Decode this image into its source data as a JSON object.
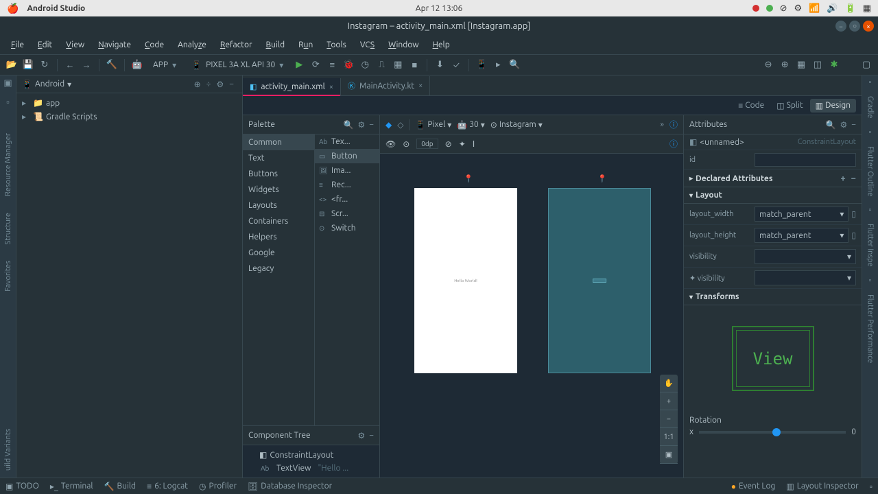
{
  "macos": {
    "app": "Android Studio",
    "datetime": "Apr 12  13:06"
  },
  "window": {
    "title": "Instagram – activity_main.xml [Instagram.app]"
  },
  "menu": [
    "File",
    "Edit",
    "View",
    "Navigate",
    "Code",
    "Analyze",
    "Refactor",
    "Build",
    "Run",
    "Tools",
    "VCS",
    "Window",
    "Help"
  ],
  "toolbar": {
    "config": "APP",
    "device": "PIXEL 3A XL API 30"
  },
  "project": {
    "view": "Android",
    "items": [
      "app",
      "Gradle Scripts"
    ]
  },
  "tabs": [
    {
      "name": "activity_main.xml",
      "active": true
    },
    {
      "name": "MainActivity.kt",
      "active": false
    }
  ],
  "view_modes": [
    "Code",
    "Split",
    "Design"
  ],
  "palette": {
    "title": "Palette",
    "categories": [
      "Common",
      "Text",
      "Buttons",
      "Widgets",
      "Layouts",
      "Containers",
      "Helpers",
      "Google",
      "Legacy"
    ],
    "items": [
      "Tex...",
      "Button",
      "Ima...",
      "Rec...",
      "<fr...",
      "Scr...",
      "Switch"
    ]
  },
  "component_tree": {
    "title": "Component Tree",
    "root": "ConstraintLayout",
    "child": "TextView",
    "child_text": "\"Hello ..."
  },
  "canvas": {
    "device_drop": "Pixel",
    "api_drop": "30",
    "theme_drop": "Instagram",
    "default_margin": "0dp",
    "hello_text": "Hello World!"
  },
  "attributes": {
    "title": "Attributes",
    "component": "<unnamed>",
    "type": "ConstraintLayout",
    "id_label": "id",
    "declared": "Declared Attributes",
    "layout": "Layout",
    "width_label": "layout_width",
    "width_value": "match_parent",
    "height_label": "layout_height",
    "height_value": "match_parent",
    "visibility_label": "visibility",
    "visibility2_label": "visibility",
    "transforms": "Transforms",
    "view_text": "View",
    "rotation": "Rotation",
    "rotation_axis": "x",
    "rotation_value": "0"
  },
  "left_tools": [
    "Resource Manager",
    "Structure",
    "Favorites",
    "uild Variants"
  ],
  "right_tools": [
    "Gradle",
    "Flutter Outline",
    "Flutter Inspe",
    "Flutter Performance"
  ],
  "status": {
    "todo": "TODO",
    "terminal": "Terminal",
    "build": "Build",
    "logcat": "6: Logcat",
    "profiler": "Profiler",
    "db": "Database Inspector",
    "event_log": "Event Log",
    "layout_inspector": "Layout Inspector"
  }
}
